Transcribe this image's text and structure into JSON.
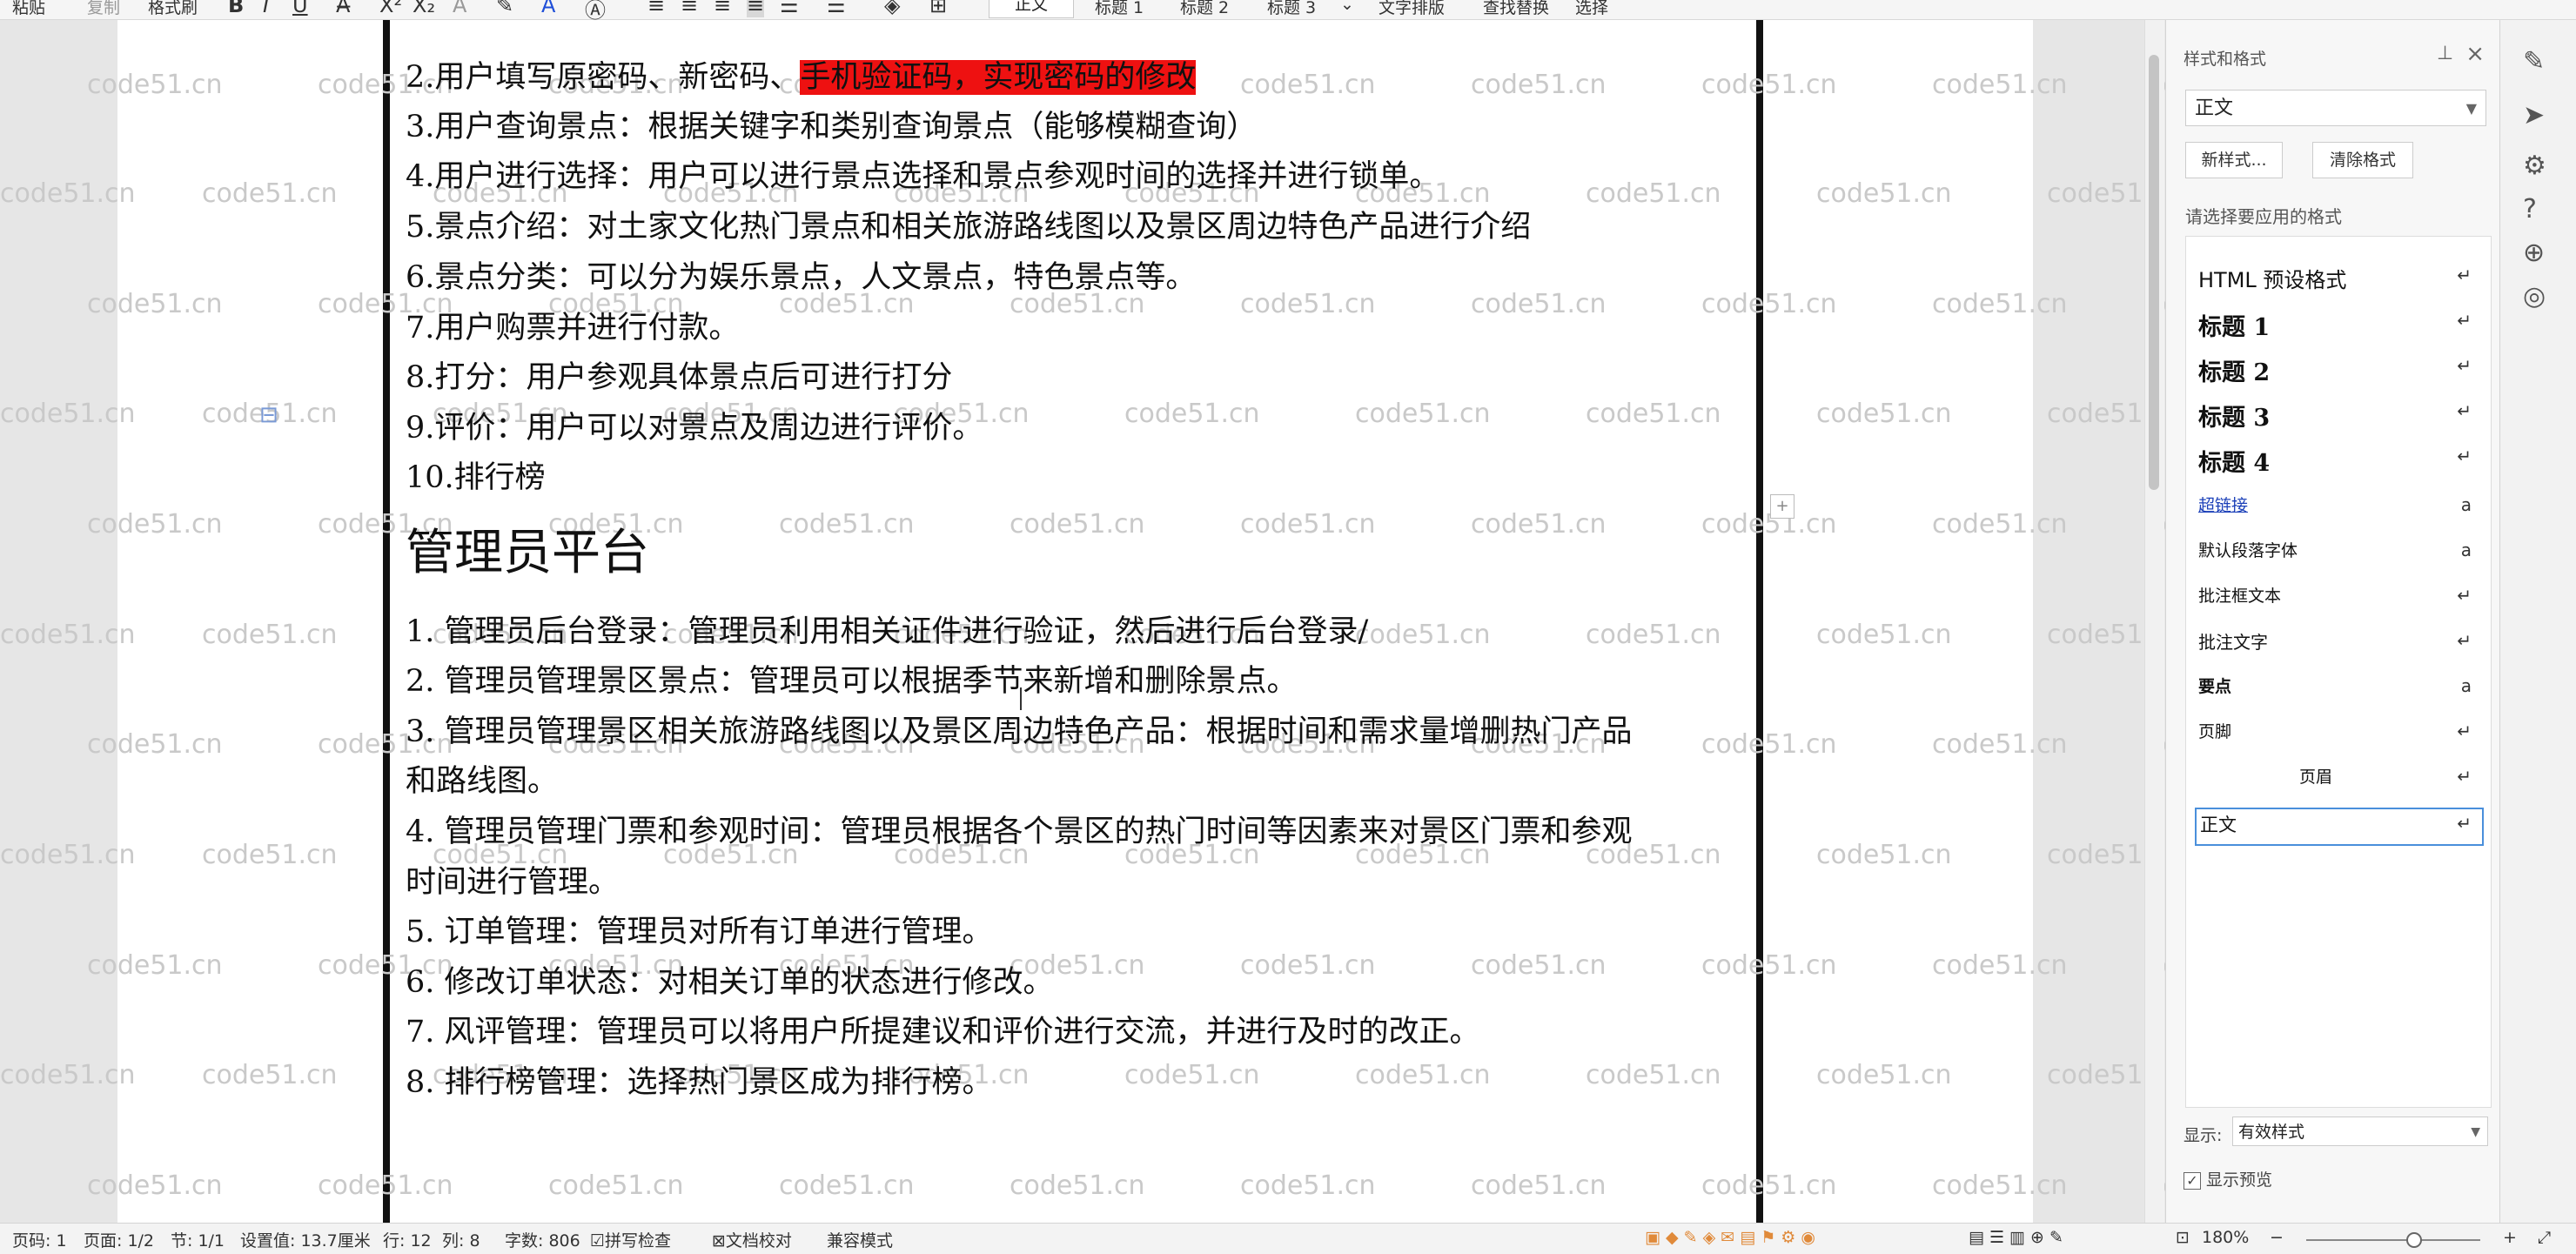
{
  "toolbar": {
    "paste": "粘贴",
    "copy": "复制",
    "format_painter": "格式刷",
    "bold": "B",
    "italic": "I",
    "underline": "U",
    "style_normal": "正文",
    "style_h1": "标题 1",
    "style_h2": "标题 2",
    "style_h3": "标题 3",
    "text_layout": "文字排版",
    "find_replace": "查找替换",
    "select": "选择"
  },
  "document": {
    "line2_a": "2.用户填写原密码、新密码、",
    "line2_b": "手机验证码，实现密码的修改",
    "line3": "3.用户查询景点：根据关键字和类别查询景点（能够模糊查询）",
    "line4": "4.用户进行选择：用户可以进行景点选择和景点参观时间的选择并进行锁单。",
    "line5": "5.景点介绍：对土家文化热门景点和相关旅游路线图以及景区周边特色产品进行介绍",
    "line6": "6.景点分类：可以分为娱乐景点，人文景点，特色景点等。",
    "line7": "7.用户购票并进行付款。",
    "line8": "8.打分：用户参观具体景点后可进行打分",
    "line9": "9.评价：用户可以对景点及周边进行评价。",
    "line10": "10.排行榜",
    "heading": "管理员平台",
    "admin1": "1. 管理员后台登录：管理员利用相关证件进行验证，然后进行后台登录/",
    "admin2": "2. 管理员管理景区景点：管理员可以根据季节来新增和删除景点。",
    "admin3a": "3. 管理员管理景区相关旅游路线图以及景区周边特色产品：根据时间和需求量增删热门产品",
    "admin3b": "和路线图。",
    "admin4a": "4. 管理员管理门票和参观时间：管理员根据各个景区的热门时间等因素来对景区门票和参观",
    "admin4b": "时间进行管理。",
    "admin5": "5. 订单管理：管理员对所有订单进行管理。",
    "admin6": "6. 修改订单状态：对相关订单的状态进行修改。",
    "admin7": "7. 风评管理：管理员可以将用户所提建议和评价进行交流，并进行及时的改正。",
    "admin8": "8. 排行榜管理：选择热门景区成为排行榜。"
  },
  "watermark": "code51.cn",
  "panel": {
    "title": "样式和格式",
    "current_style": "正文",
    "new_style": "新样式...",
    "clear_format": "清除格式",
    "apply_label": "请选择要应用的格式",
    "styles": [
      {
        "label": "HTML 预设格式",
        "mark": "↵"
      },
      {
        "label": "标题 1",
        "mark": "↵"
      },
      {
        "label": "标题 2",
        "mark": "↵"
      },
      {
        "label": "标题 3",
        "mark": "↵"
      },
      {
        "label": "标题 4",
        "mark": "↵"
      },
      {
        "label": "超链接",
        "mark": "a"
      },
      {
        "label": "默认段落字体",
        "mark": "a"
      },
      {
        "label": "批注框文本",
        "mark": "↵"
      },
      {
        "label": "批注文字",
        "mark": "↵"
      },
      {
        "label": "要点",
        "mark": "a"
      },
      {
        "label": "页脚",
        "mark": "↵"
      },
      {
        "label": "页眉",
        "mark": "↵"
      },
      {
        "label": "正文",
        "mark": "↵"
      }
    ],
    "show_label": "显示:",
    "show_value": "有效样式",
    "preview_label": "显示预览"
  },
  "status": {
    "page_num": "页码: 1",
    "pages": "页面: 1/2",
    "section": "节: 1/1",
    "setting": "设置值: 13.7厘米",
    "row": "行: 12",
    "col": "列: 8",
    "words": "字数: 806",
    "spell": "拼写检查",
    "proof": "文档校对",
    "compat": "兼容模式",
    "zoom": "180%"
  }
}
